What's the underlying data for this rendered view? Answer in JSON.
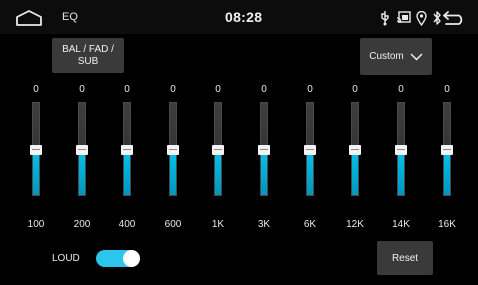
{
  "status_bar": {
    "title": "EQ",
    "time": "08:28",
    "icons": [
      "home-icon",
      "usb-icon",
      "screen-cast-icon",
      "location-pin-icon",
      "bluetooth-icon",
      "back-icon"
    ]
  },
  "buttons": {
    "balance_label": "BAL / FAD /\nSUB",
    "preset_label": "Custom",
    "reset_label": "Reset"
  },
  "eq": {
    "level_fraction": 0.5,
    "bands": [
      {
        "freq": "100",
        "value": "0"
      },
      {
        "freq": "200",
        "value": "0"
      },
      {
        "freq": "400",
        "value": "0"
      },
      {
        "freq": "600",
        "value": "0"
      },
      {
        "freq": "1K",
        "value": "0"
      },
      {
        "freq": "3K",
        "value": "0"
      },
      {
        "freq": "6K",
        "value": "0"
      },
      {
        "freq": "12K",
        "value": "0"
      },
      {
        "freq": "14K",
        "value": "0"
      },
      {
        "freq": "16K",
        "value": "0"
      }
    ]
  },
  "loudness": {
    "label": "LOUD",
    "enabled": true
  },
  "colors": {
    "accent": "#00b4dc",
    "toggle_on": "#2cc5ec",
    "button_bg": "#3a3a3a"
  }
}
